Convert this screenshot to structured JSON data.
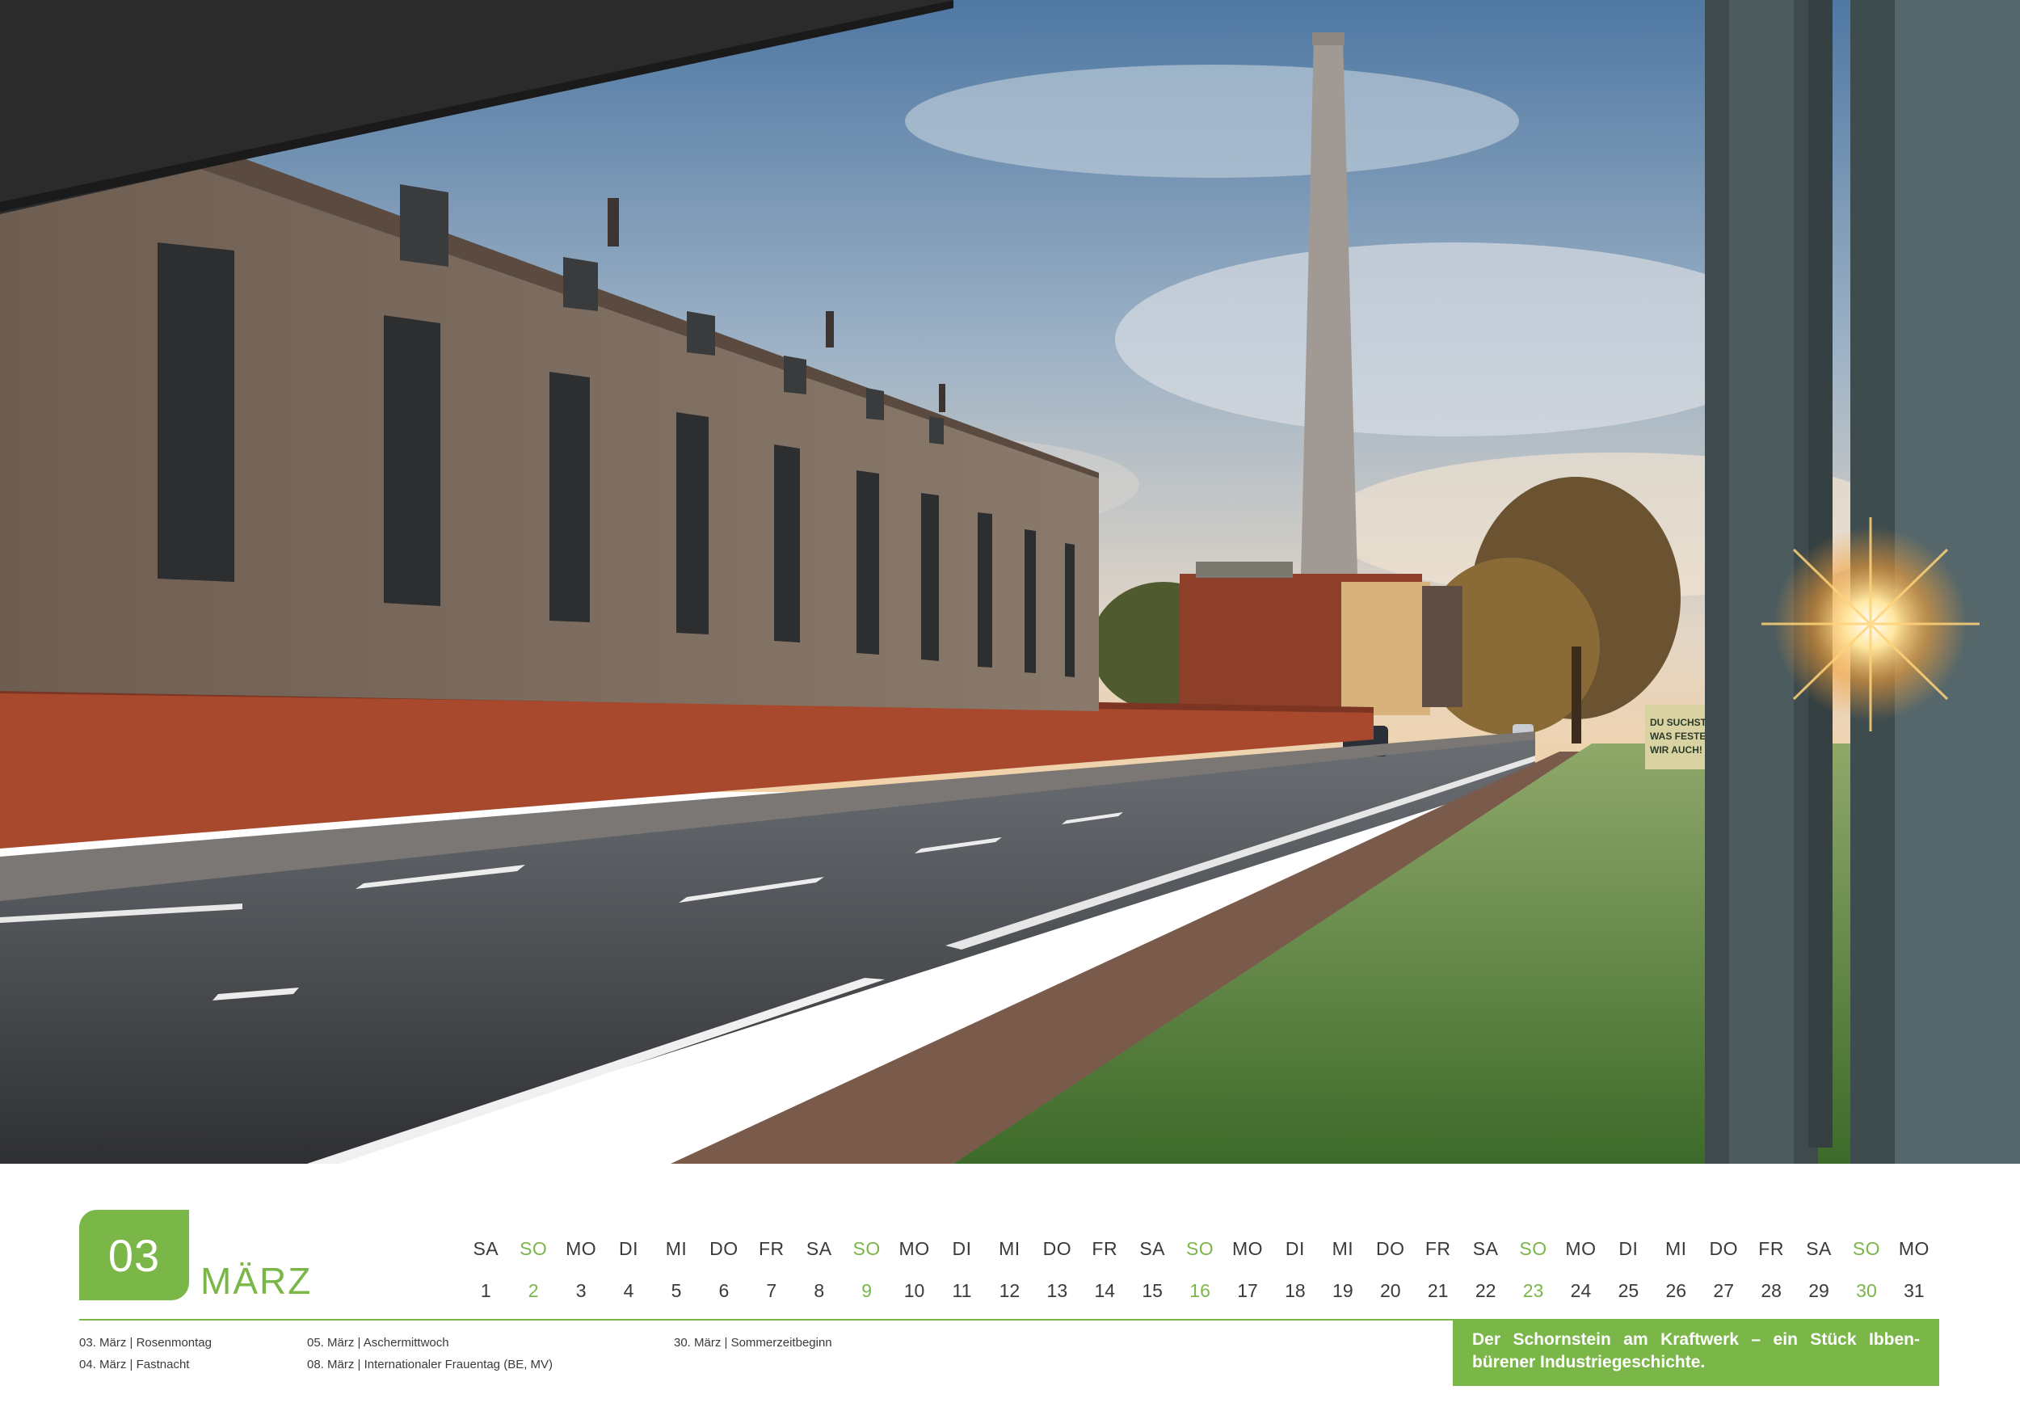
{
  "photo": {
    "description_icon": "photo-industrial-street",
    "billboard_lines": [
      "DU SUCHST",
      "WAS FESTES",
      "WIR AUCH!"
    ]
  },
  "month": {
    "number": "03",
    "name": "MÄRZ"
  },
  "days": [
    {
      "wd": "SA",
      "d": "1"
    },
    {
      "wd": "SO",
      "d": "2"
    },
    {
      "wd": "MO",
      "d": "3"
    },
    {
      "wd": "DI",
      "d": "4"
    },
    {
      "wd": "MI",
      "d": "5"
    },
    {
      "wd": "DO",
      "d": "6"
    },
    {
      "wd": "FR",
      "d": "7"
    },
    {
      "wd": "SA",
      "d": "8"
    },
    {
      "wd": "SO",
      "d": "9"
    },
    {
      "wd": "MO",
      "d": "10"
    },
    {
      "wd": "DI",
      "d": "11"
    },
    {
      "wd": "MI",
      "d": "12"
    },
    {
      "wd": "DO",
      "d": "13"
    },
    {
      "wd": "FR",
      "d": "14"
    },
    {
      "wd": "SA",
      "d": "15"
    },
    {
      "wd": "SO",
      "d": "16"
    },
    {
      "wd": "MO",
      "d": "17"
    },
    {
      "wd": "DI",
      "d": "18"
    },
    {
      "wd": "MI",
      "d": "19"
    },
    {
      "wd": "DO",
      "d": "20"
    },
    {
      "wd": "FR",
      "d": "21"
    },
    {
      "wd": "SA",
      "d": "22"
    },
    {
      "wd": "SO",
      "d": "23"
    },
    {
      "wd": "MO",
      "d": "24"
    },
    {
      "wd": "DI",
      "d": "25"
    },
    {
      "wd": "MI",
      "d": "26"
    },
    {
      "wd": "DO",
      "d": "27"
    },
    {
      "wd": "FR",
      "d": "28"
    },
    {
      "wd": "SA",
      "d": "29"
    },
    {
      "wd": "SO",
      "d": "30"
    },
    {
      "wd": "MO",
      "d": "31"
    }
  ],
  "holidays": {
    "col1": [
      "03. März | Rosenmontag",
      "04. März | Fastnacht"
    ],
    "col2": [
      "05. März | Aschermittwoch",
      "08. März | Internationaler Frauentag (BE, MV)"
    ],
    "col3": [
      "30. März | Sommerzeitbeginn"
    ]
  },
  "caption": "Der Schornstein am Kraftwerk – ein Stück Ibben­bürener Industriegeschichte.",
  "colors": {
    "accent": "#7ab648",
    "text": "#3a3a3a",
    "brick": "#a8492e",
    "sky": "#6a8fb5"
  }
}
